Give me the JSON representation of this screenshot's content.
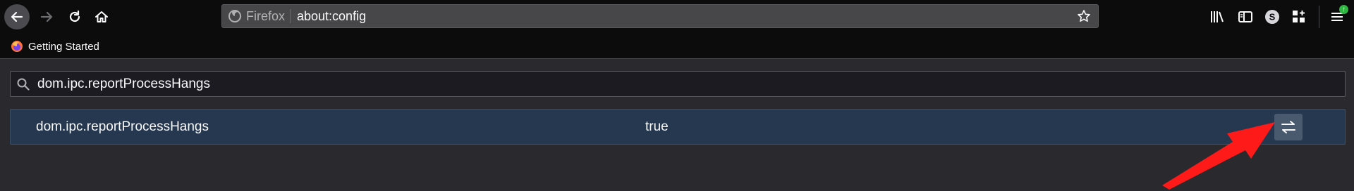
{
  "toolbar": {
    "identity_label": "Firefox",
    "url": "about:config",
    "sync_letter": "S",
    "update_badge": "↑"
  },
  "bookmarks": {
    "items": [
      {
        "label": "Getting Started"
      }
    ]
  },
  "search": {
    "value": "dom.ipc.reportProcessHangs"
  },
  "preferences": [
    {
      "name": "dom.ipc.reportProcessHangs",
      "value": "true"
    }
  ],
  "colors": {
    "toolbar_bg": "#0c0c0d",
    "content_bg": "#2a2a2e",
    "row_bg": "#25384f",
    "annotation_arrow": "#ff1a1a",
    "update_badge": "#30b642"
  },
  "icons": {
    "back": "back-arrow-icon",
    "forward": "forward-arrow-icon",
    "reload": "reload-icon",
    "home": "home-icon",
    "star": "bookmark-star-icon",
    "toggle": "toggle-arrows-icon"
  }
}
